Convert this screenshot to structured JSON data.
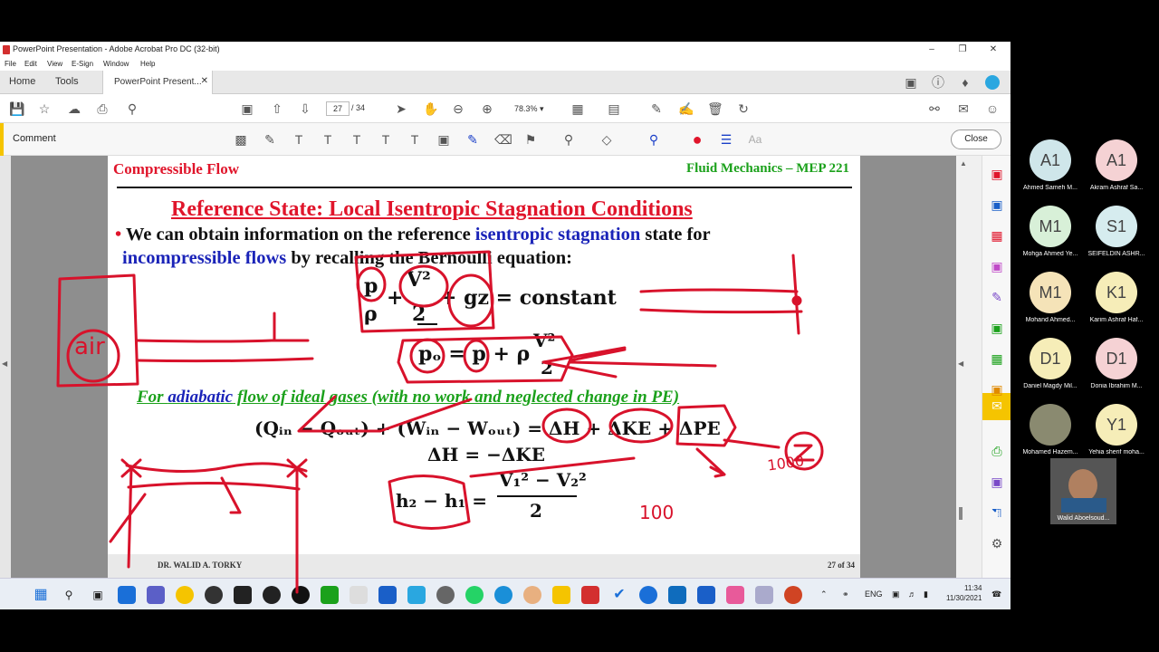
{
  "window": {
    "title": "PowerPoint Presentation - Adobe Acrobat Pro DC (32-bit)"
  },
  "menu": [
    "File",
    "Edit",
    "View",
    "E-Sign",
    "Window",
    "Help"
  ],
  "tabs": {
    "home": "Home",
    "tools": "Tools",
    "doc": "PowerPoint Present..."
  },
  "toolbar": {
    "page_current": "27",
    "page_total": "/ 34",
    "zoom": "78.3%"
  },
  "comment": {
    "label": "Comment",
    "close": "Close",
    "font_label": "Aa"
  },
  "slide": {
    "header_left": "Compressible Flow",
    "header_right": "Fluid Mechanics – MEP 221",
    "heading": "Reference State: Local Isentropic Stagnation Conditions",
    "bullet_mark": "•",
    "b1_a": " We can obtain information on the reference ",
    "b1_b": "isentropic stagnation",
    "b1_c": " state for",
    "b2_a": "incompressible flows",
    "b2_b": " by recalling the Bernoulli equation:",
    "bern_p": "p",
    "bern_rho": "ρ",
    "bern_v2": "V²",
    "bern_2": "2",
    "bern_plus": "+",
    "bern_gz": "+ gz = constant",
    "stag_lhs": "pₒ = p + ρ",
    "stag_v2": "V²",
    "stag_2": "2",
    "adiab_a": "For ",
    "adiab_b": "adiabatic",
    "adiab_c": " flow of ideal gases (with no work and neglected change in PE)",
    "energy": "(Qᵢₙ − Qₒᵤₜ) + (Wᵢₙ − Wₒᵤₜ) = ΔH + ΔKE + ΔPE",
    "dh": "ΔH = −ΔKE",
    "h_lhs": "h₂ − h₁ =",
    "h_num": "V₁² − V₂²",
    "h_den": "2",
    "footer_left": "DR. WALID A. TORKY",
    "footer_right": "27 of 34"
  },
  "ink_text": {
    "air": "air",
    "n1000": "1000",
    "n100": "100"
  },
  "participants": [
    {
      "initials": "A1",
      "name": "Ahmed Sameh M...",
      "color": "#cfe6ea"
    },
    {
      "initials": "A1",
      "name": "Akram Ashraf Sa...",
      "color": "#f5d2d4"
    },
    {
      "initials": "M1",
      "name": "Mohga Ahmed Ye...",
      "color": "#d8f0d8"
    },
    {
      "initials": "S1",
      "name": "SEIFELDIN ASHR...",
      "color": "#d6ecef"
    },
    {
      "initials": "M1",
      "name": "Mohand Ahmed...",
      "color": "#f5e3b8"
    },
    {
      "initials": "K1",
      "name": "Karim Ashraf Haf...",
      "color": "#f6edb8"
    },
    {
      "initials": "D1",
      "name": "Daniel Magdy Mil...",
      "color": "#f6edb8"
    },
    {
      "initials": "D1",
      "name": "Donia Ibrahim M...",
      "color": "#f5d2d4"
    },
    {
      "initials": "",
      "name": "Mohamed Hazem...",
      "color": "#8a8a70"
    },
    {
      "initials": "Y1",
      "name": "Yehia sherif moha...",
      "color": "#f6edb8"
    }
  ],
  "self_view": {
    "name": "Walid Aboelsoud..."
  },
  "taskbar": {
    "lang": "ENG",
    "time": "11:34",
    "date": "11/30/2021"
  }
}
